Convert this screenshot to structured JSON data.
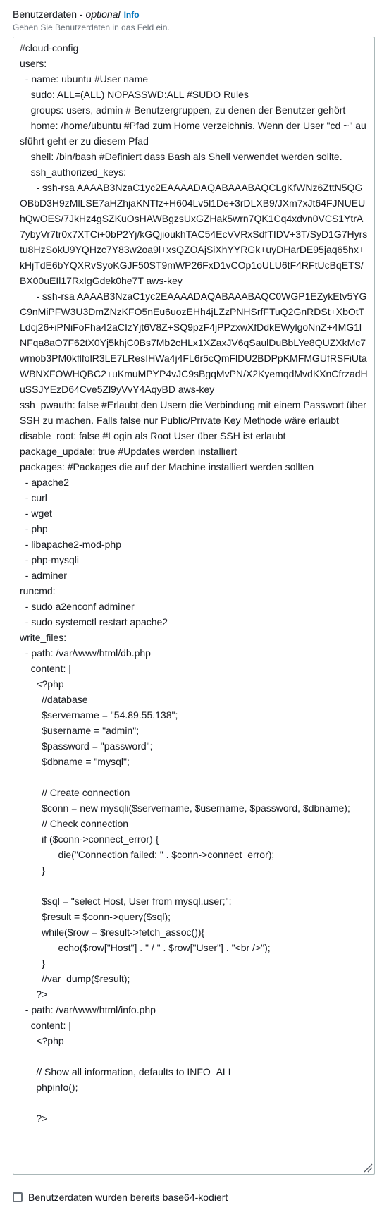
{
  "field": {
    "label": "Benutzerdaten",
    "separator": " - ",
    "optional": "optional",
    "info_link": "Info",
    "description": "Geben Sie Benutzerdaten in das Feld ein."
  },
  "textarea": {
    "value": "#cloud-config\nusers:\n  - name: ubuntu #User name\n    sudo: ALL=(ALL) NOPASSWD:ALL #SUDO Rules\n    groups: users, admin # Benutzergruppen, zu denen der Benutzer gehört\n    home: /home/ubuntu #Pfad zum Home verzeichnis. Wenn der User \"cd ~\" ausführt geht er zu diesem Pfad\n    shell: /bin/bash #Definiert dass Bash als Shell verwendet werden sollte.\n    ssh_authorized_keys:\n      - ssh-rsa AAAAB3NzaC1yc2EAAAADAQABAAABAQCLgKfWNz6ZttN5QGOBbD3H9zMlLSE7aHZhjaKNTfz+H604Lv5l1De+3rDLXB9/JXm7xJt64FJNUEUhQwOES/7JkHz4gSZKuOsHAWBgzsUxGZHak5wrn7QK1Cq4xdvn0VCS1YtrA7ybyVr7tr0x7XTCi+0bP2Yj/kGQjioukhTAC54EcVVRxSdfTIDV+3T/SyD1G7Hyrstu8HzSokU9YQHzc7Y83w2oa9l+xsQZOAjSiXhYYRGk+uyDHarDE95jaq65hx+kHjTdE6bYQXRvSyoKGJF50ST9mWP26FxD1vCOp1oULU6tF4RFtUcBqETS/BX00uEIl17RxIgGdek0he7T aws-key\n      - ssh-rsa AAAAB3NzaC1yc2EAAAADAQABAAABAQC0WGP1EZykEtv5YGC9nMiPFW3U3DmZNzKFO5nEu6uozEHh4jLZzPNHSrfFTuQ2GnRDSt+XbOtTLdcj26+iPNiFoFha42aCIzYjt6V8Z+SQ9pzF4jPPzxwXfDdkEWylgoNnZ+4MG1lNFqa8aO7F62tX0Yj5khjC0Bs7Mb2cHLx1XZaxJV6qSaulDuBbLYe8QUZXkMc7wmob3PM0kflfolR3LE7LResIHWa4j4FL6r5cQmFlDU2BDPpKMFMGUfRSFiUtaWBNXFOWHQBC2+uKmuMPYP4vJC9sBgqMvPN/X2KyemqdMvdKXnCfrzadHuSSJYEzD64Cve5Zl9yVvY4AqyBD aws-key\nssh_pwauth: false #Erlaubt den Usern die Verbindung mit einem Passwort über SSH zu machen. Falls false nur Public/Private Key Methode wäre erlaubt\ndisable_root: false #Login als Root User über SSH ist erlaubt\npackage_update: true #Updates werden installiert\npackages: #Packages die auf der Machine installiert werden sollten\n  - apache2\n  - curl\n  - wget\n  - php\n  - libapache2-mod-php\n  - php-mysqli\n  - adminer\nruncmd:\n  - sudo a2enconf adminer\n  - sudo systemctl restart apache2\nwrite_files:\n  - path: /var/www/html/db.php\n    content: |\n      <?php\n        //database\n        $servername = \"54.89.55.138\";\n        $username = \"admin\";\n        $password = \"password\";\n        $dbname = \"mysql\";\n\n        // Create connection\n        $conn = new mysqli($servername, $username, $password, $dbname);\n        // Check connection\n        if ($conn->connect_error) {\n              die(\"Connection failed: \" . $conn->connect_error);\n        }\n\n        $sql = \"select Host, User from mysql.user;\";\n        $result = $conn->query($sql);\n        while($row = $result->fetch_assoc()){\n              echo($row[\"Host\"] . \" / \" . $row[\"User\"] . \"<br />\");\n        }\n        //var_dump($result);\n      ?>\n  - path: /var/www/html/info.php\n    content: |\n      <?php\n\n      // Show all information, defaults to INFO_ALL\n      phpinfo();\n\n      ?>"
  },
  "checkbox": {
    "label": "Benutzerdaten wurden bereits base64-kodiert",
    "checked": false
  },
  "colors": {
    "text": "#16191f",
    "description": "#687078",
    "link": "#0073bb",
    "border": "#aab7b8"
  }
}
